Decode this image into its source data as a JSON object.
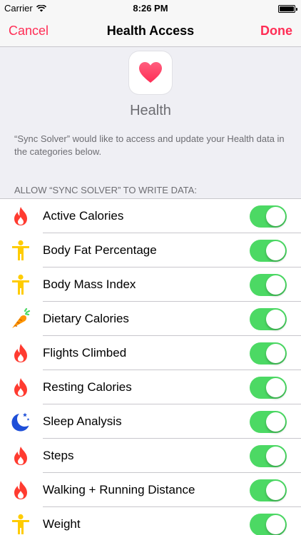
{
  "status_bar": {
    "carrier": "Carrier",
    "time": "8:26 PM",
    "battery_level": 1.0
  },
  "navbar": {
    "cancel_label": "Cancel",
    "title": "Health Access",
    "done_label": "Done"
  },
  "header": {
    "app_name": "Health",
    "description": "“Sync Solver” would like to access and update your Health data in the categories below.",
    "section_title": "ALLOW “SYNC SOLVER” TO WRITE DATA:"
  },
  "colors": {
    "accent": "#ff2d55",
    "toggle_on": "#4cd964",
    "flame": "#ff3b30",
    "figure": "#ffcc00",
    "moon": "#1e4fd8",
    "carrot": "#ff9500"
  },
  "items": [
    {
      "label": "Active Calories",
      "icon": "flame-icon",
      "enabled": true
    },
    {
      "label": "Body Fat Percentage",
      "icon": "figure-icon",
      "enabled": true
    },
    {
      "label": "Body Mass Index",
      "icon": "figure-icon",
      "enabled": true
    },
    {
      "label": "Dietary Calories",
      "icon": "carrot-icon",
      "enabled": true
    },
    {
      "label": "Flights Climbed",
      "icon": "flame-icon",
      "enabled": true
    },
    {
      "label": "Resting Calories",
      "icon": "flame-icon",
      "enabled": true
    },
    {
      "label": "Sleep Analysis",
      "icon": "moon-icon",
      "enabled": true
    },
    {
      "label": "Steps",
      "icon": "flame-icon",
      "enabled": true
    },
    {
      "label": "Walking + Running Distance",
      "icon": "flame-icon",
      "enabled": true
    },
    {
      "label": "Weight",
      "icon": "figure-icon",
      "enabled": true
    }
  ]
}
